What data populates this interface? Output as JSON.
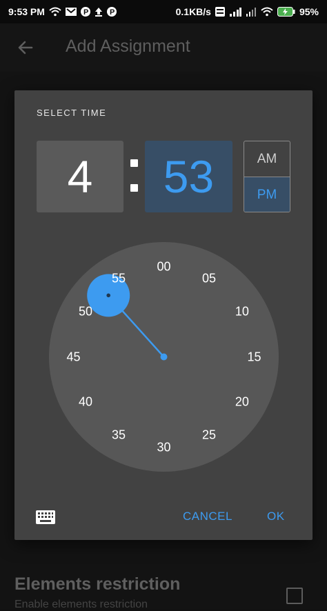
{
  "status_bar": {
    "time": "9:53 PM",
    "speed": "0.1KB/s",
    "battery": "95%",
    "icons": [
      "wifi-icon",
      "gmail-icon",
      "p-app-icon",
      "upload-icon",
      "p-app-icon",
      "volte-icon",
      "signal-icon",
      "signal-icon",
      "wifi-icon",
      "battery-charging-icon"
    ]
  },
  "app_bar": {
    "title": "Add Assignment",
    "back_icon": "arrow-left-icon"
  },
  "dialog": {
    "label": "SELECT TIME",
    "hour": "4",
    "minute": "53",
    "am": "AM",
    "pm": "PM",
    "selected_period": "PM",
    "selected_minute": 53,
    "clock_labels": [
      "00",
      "05",
      "10",
      "15",
      "20",
      "25",
      "30",
      "35",
      "40",
      "45",
      "50",
      "55"
    ],
    "keyboard_icon": "keyboard-icon",
    "cancel": "CANCEL",
    "ok": "OK"
  },
  "underlying": {
    "title": "Elements restriction",
    "subtitle": "Enable elements restriction"
  },
  "colors": {
    "accent": "#3d9bf0",
    "dialog_bg": "#424242",
    "clock_face": "#575757",
    "selected_box": "#374e66"
  }
}
